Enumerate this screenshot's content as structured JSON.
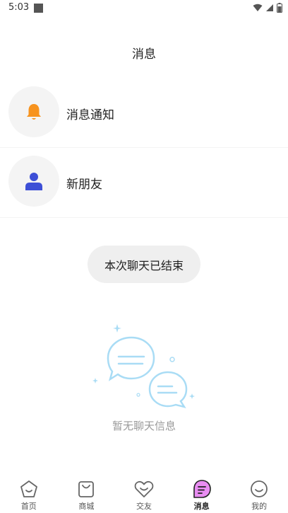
{
  "status_bar": {
    "time": "5:03"
  },
  "header": {
    "title": "消息"
  },
  "list": [
    {
      "label": "消息通知",
      "icon": "bell-icon",
      "icon_color": "#f7931e"
    },
    {
      "label": "新朋友",
      "icon": "person-icon",
      "icon_color": "#3d4fd6"
    }
  ],
  "toast": {
    "text": "本次聊天已结束"
  },
  "empty_state": {
    "text": "暂无聊天信息",
    "icon": "chat-bubbles-icon",
    "accent": "#a9dcf5"
  },
  "bottom_nav": {
    "active_color": "#e98df2",
    "items": [
      {
        "label": "首页",
        "icon": "home-pentagon-icon"
      },
      {
        "label": "商城",
        "icon": "shopping-bag-icon"
      },
      {
        "label": "交友",
        "icon": "heart-icon"
      },
      {
        "label": "消息",
        "icon": "message-bubble-icon",
        "active": true
      },
      {
        "label": "我的",
        "icon": "smile-face-icon"
      }
    ]
  }
}
